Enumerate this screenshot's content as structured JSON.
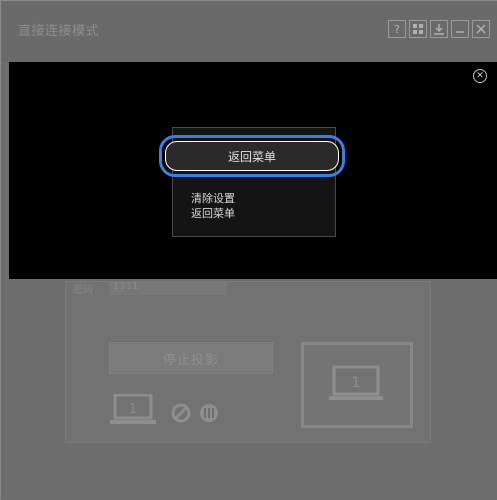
{
  "window": {
    "title": "直接连接模式",
    "buttons": [
      "help-icon",
      "grid-icon",
      "download-icon",
      "minimize-icon",
      "close-icon"
    ]
  },
  "background_panel": {
    "input_label": "密码",
    "input_value": "1111",
    "stop_button_label": "停止投影",
    "laptop_label": "1",
    "monitor_label": "1"
  },
  "overlay_menu": {
    "selected_item": "返回菜单",
    "items": [
      "清除设置",
      "返回菜单"
    ]
  },
  "colors": {
    "accent": "#3b7fe6",
    "overlay": "#000000",
    "window_bg": "#6c6c6c"
  }
}
